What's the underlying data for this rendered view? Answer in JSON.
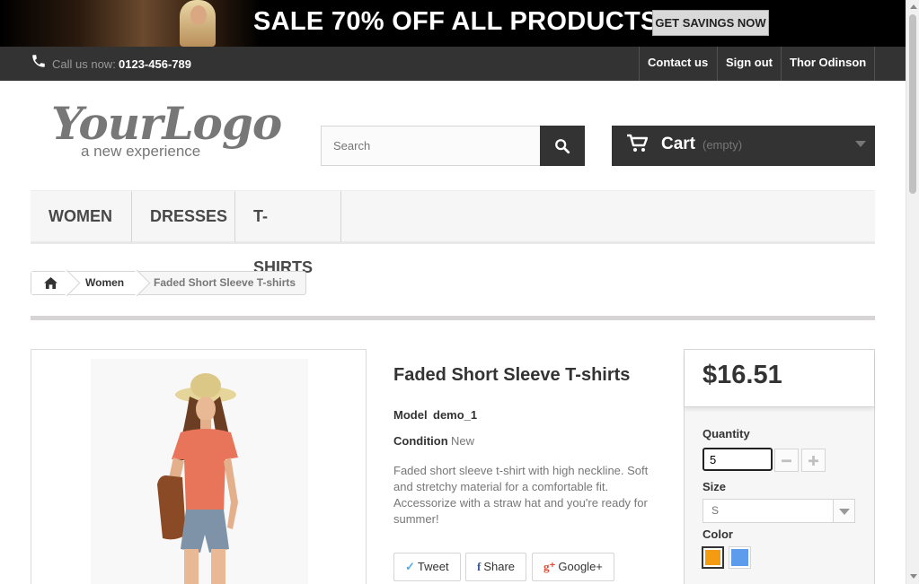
{
  "banner": {
    "sale_text": "SALE 70% OFF ALL PRODUCTS",
    "button_label": "GET SAVINGS NOW"
  },
  "topnav": {
    "call_label": "Call us now:",
    "phone_number": "0123-456-789",
    "links": [
      "Contact us",
      "Sign out",
      "Thor Odinson"
    ]
  },
  "header": {
    "logo_main": "YourLogo",
    "logo_sub": "a new experience",
    "search_placeholder": "Search",
    "cart_label": "Cart",
    "cart_status": "(empty)"
  },
  "menu": {
    "items": [
      "WOMEN",
      "DRESSES",
      "T-SHIRTS"
    ]
  },
  "breadcrumb": {
    "category": "Women",
    "current": "Faded Short Sleeve T-shirts"
  },
  "product": {
    "name": "Faded Short Sleeve T-shirts",
    "model_label": "Model",
    "model_value": "demo_1",
    "condition_label": "Condition",
    "condition_value": "New",
    "description": "Faded short sleeve t-shirt with high neckline. Soft and stretchy material for a comfortable fit. Accessorize with a straw hat and you're ready for summer!",
    "social": {
      "tweet": "Tweet",
      "share": "Share",
      "google": "Google+"
    }
  },
  "buybox": {
    "price": "$16.51",
    "quantity_label": "Quantity",
    "quantity_value": "5",
    "size_label": "Size",
    "size_value": "S",
    "color_label": "Color",
    "colors": [
      "#f39c11",
      "#5d9cec"
    ]
  }
}
